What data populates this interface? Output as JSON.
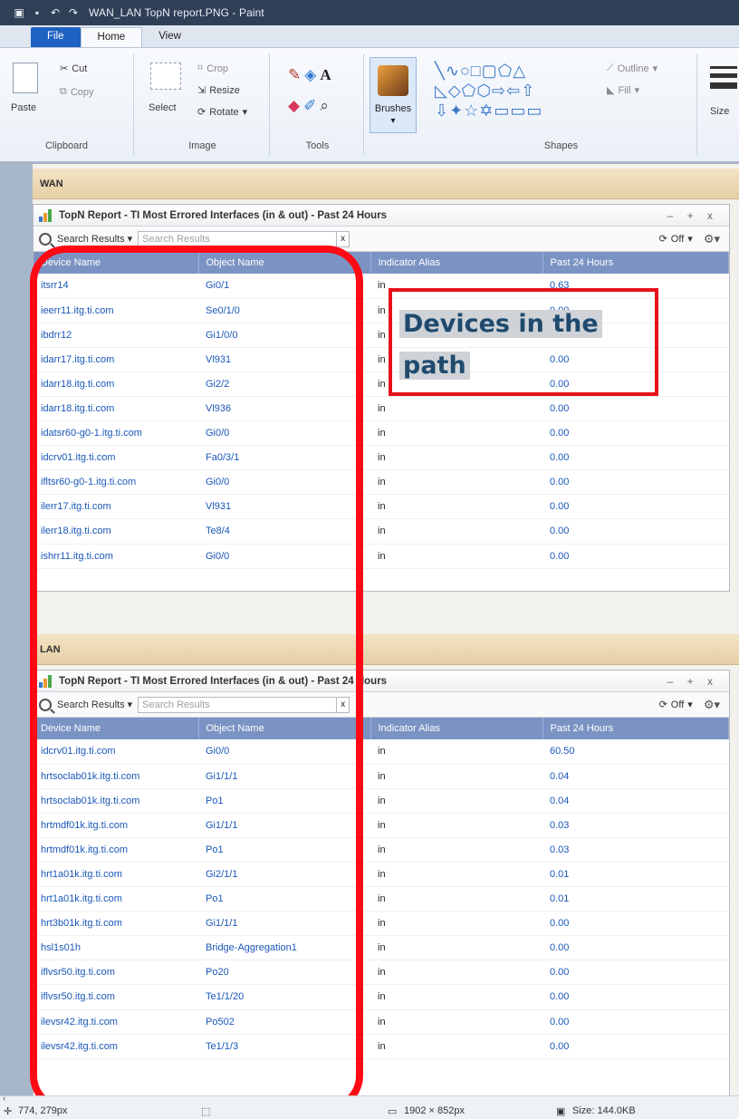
{
  "window": {
    "title": "WAN_LAN TopN report.PNG - Paint"
  },
  "ribbon": {
    "tabs": [
      "File",
      "Home",
      "View"
    ],
    "clipboard": {
      "paste": "Paste",
      "cut": "Cut",
      "copy": "Copy",
      "label": "Clipboard"
    },
    "image": {
      "select": "Select",
      "crop": "Crop",
      "resize": "Resize",
      "rotate": "Rotate",
      "label": "Image"
    },
    "tools": {
      "label": "Tools"
    },
    "brushes": {
      "label": "Brushes"
    },
    "shapes": {
      "outline": "Outline",
      "fill": "Fill",
      "label": "Shapes"
    },
    "size": {
      "label": "Size"
    }
  },
  "wan": {
    "section_label": "WAN",
    "panel_title": "TopN Report - TI Most Errored Interfaces (in & out) - Past 24 Hours",
    "search_label": "Search Results",
    "search_placeholder": "Search Results",
    "refresh_label": "Off",
    "columns": [
      "Device Name",
      "Object Name",
      "Indicator Alias",
      "Past 24 Hours"
    ],
    "rows": [
      [
        "itsrr14",
        "Gi0/1",
        "in",
        "0.63"
      ],
      [
        "ieerr11.itg.ti.com",
        "Se0/1/0",
        "in",
        "0.00"
      ],
      [
        "ibdrr12",
        "Gi1/0/0",
        "in",
        "0.00"
      ],
      [
        "idarr17.itg.ti.com",
        "Vl931",
        "in",
        "0.00"
      ],
      [
        "idarr18.itg.ti.com",
        "Gi2/2",
        "in",
        "0.00"
      ],
      [
        "idarr18.itg.ti.com",
        "Vl936",
        "in",
        "0.00"
      ],
      [
        "idatsr60-g0-1.itg.ti.com",
        "Gi0/0",
        "in",
        "0.00"
      ],
      [
        "idcrv01.itg.ti.com",
        "Fa0/3/1",
        "in",
        "0.00"
      ],
      [
        "ifltsr60-g0-1.itg.ti.com",
        "Gi0/0",
        "in",
        "0.00"
      ],
      [
        "ilerr17.itg.ti.com",
        "Vl931",
        "in",
        "0.00"
      ],
      [
        "ilerr18.itg.ti.com",
        "Te8/4",
        "in",
        "0.00"
      ],
      [
        "ishrr11.itg.ti.com",
        "Gi0/0",
        "in",
        "0.00"
      ]
    ]
  },
  "lan": {
    "section_label": "LAN",
    "panel_title": "TopN Report - TI Most Errored Interfaces (in & out) - Past 24 Hours",
    "search_label": "Search Results",
    "search_placeholder": "Search Results",
    "refresh_label": "Off",
    "columns": [
      "Device Name",
      "Object Name",
      "Indicator Alias",
      "Past 24 Hours"
    ],
    "rows": [
      [
        "idcrv01.itg.ti.com",
        "Gi0/0",
        "in",
        "60.50"
      ],
      [
        "hrtsoclab01k.itg.ti.com",
        "Gi1/1/1",
        "in",
        "0.04"
      ],
      [
        "hrtsoclab01k.itg.ti.com",
        "Po1",
        "in",
        "0.04"
      ],
      [
        "hrtmdf01k.itg.ti.com",
        "Gi1/1/1",
        "in",
        "0.03"
      ],
      [
        "hrtmdf01k.itg.ti.com",
        "Po1",
        "in",
        "0.03"
      ],
      [
        "hrt1a01k.itg.ti.com",
        "Gi2/1/1",
        "in",
        "0.01"
      ],
      [
        "hrt1a01k.itg.ti.com",
        "Po1",
        "in",
        "0.01"
      ],
      [
        "hrt3b01k.itg.ti.com",
        "Gi1/1/1",
        "in",
        "0.00"
      ],
      [
        "hsl1s01h",
        "Bridge-Aggregation1",
        "in",
        "0.00"
      ],
      [
        "iflvsr50.itg.ti.com",
        "Po20",
        "in",
        "0.00"
      ],
      [
        "iflvsr50.itg.ti.com",
        "Te1/1/20",
        "in",
        "0.00"
      ],
      [
        "ilevsr42.itg.ti.com",
        "Po502",
        "in",
        "0.00"
      ],
      [
        "ilevsr42.itg.ti.com",
        "Te1/1/3",
        "in",
        "0.00"
      ]
    ]
  },
  "annotation": {
    "text_line1": "Devices in the",
    "text_line2": "path",
    "color": "#e6121a"
  },
  "statusbar": {
    "cursor": "774, 279px",
    "dimensions": "1902 × 852px",
    "size": "Size: 144.0KB"
  }
}
